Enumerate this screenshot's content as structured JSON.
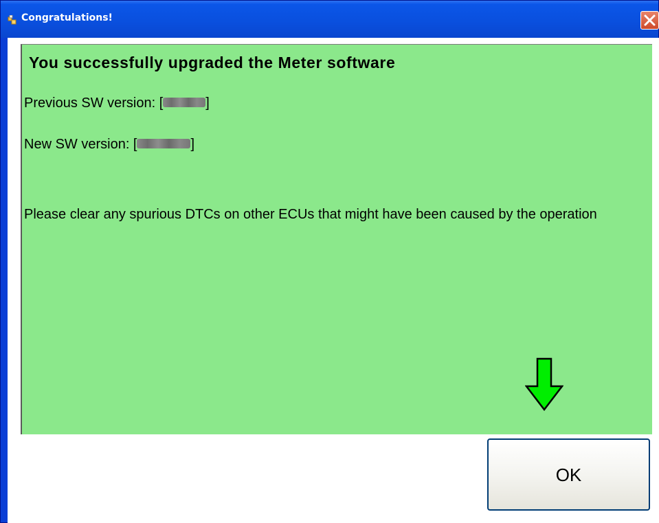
{
  "window": {
    "title": "Congratulations!",
    "close_label": "✕"
  },
  "message": {
    "headline": "You successfully upgraded the Meter software",
    "previous_version_label": "Previous SW version: [",
    "previous_version_suffix": "]",
    "new_version_label": "New SW version: [",
    "new_version_suffix": "]",
    "note": "Please clear any spurious DTCs on other ECUs that might have been caused by the operation"
  },
  "buttons": {
    "ok_label": "OK"
  },
  "colors": {
    "panel_background": "#8be88b",
    "titlebar": "#0a4fdd",
    "arrow": "#00ee00"
  },
  "icons": {
    "title": "app-icon",
    "close": "close-icon",
    "annotation": "down-arrow-icon"
  }
}
